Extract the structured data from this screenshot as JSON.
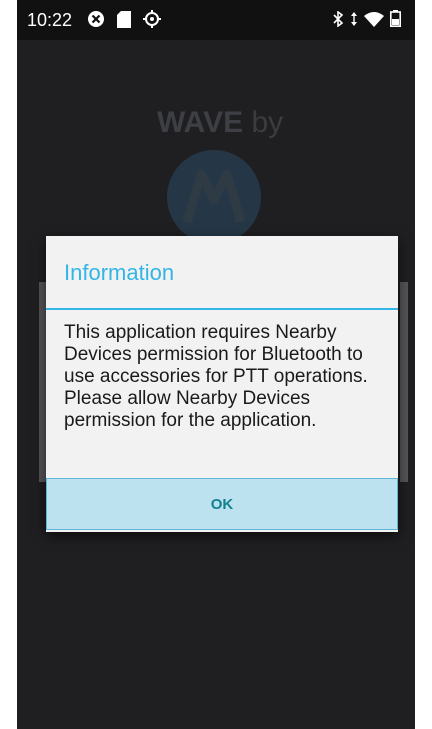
{
  "status_bar": {
    "time": "10:22",
    "left_icons": [
      "no-signal-icon",
      "sd-card-icon",
      "settings-cog-icon"
    ],
    "right_icons": [
      "bluetooth-icon",
      "data-arrows-icon",
      "wifi-icon",
      "battery-icon"
    ]
  },
  "background": {
    "logo_text": "WAVE",
    "logo_suffix": "by"
  },
  "dialog": {
    "title": "Information",
    "message": "This application requires Nearby Devices permission for Bluetooth to use accessories for PTT operations. Please allow Nearby Devices permission for the application.",
    "ok_label": "OK"
  },
  "colors": {
    "accent": "#33b5e5",
    "button_bg": "#bde2ef",
    "button_text": "#138090",
    "screen_bg": "#1f1f21"
  }
}
